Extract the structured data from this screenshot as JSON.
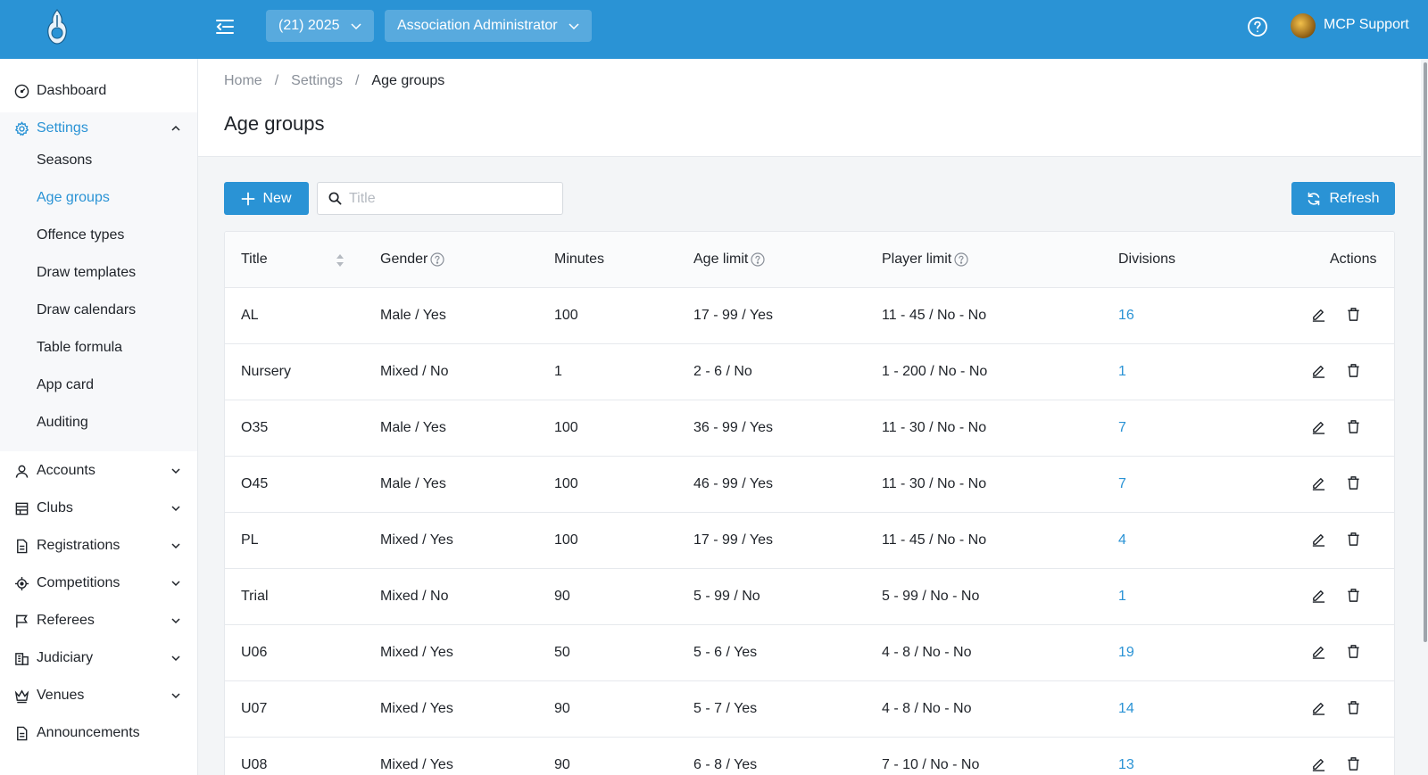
{
  "topbar": {
    "season_selector": "(21) 2025",
    "role_selector": "Association Administrator",
    "username": "MCP Support"
  },
  "sidebar": {
    "items": [
      {
        "label": "Dashboard",
        "icon": "dashboard-icon"
      },
      {
        "label": "Settings",
        "icon": "gear-icon"
      },
      {
        "label": "Accounts",
        "icon": "user-icon"
      },
      {
        "label": "Clubs",
        "icon": "building-icon"
      },
      {
        "label": "Registrations",
        "icon": "document-icon"
      },
      {
        "label": "Competitions",
        "icon": "target-icon"
      },
      {
        "label": "Referees",
        "icon": "flag-icon"
      },
      {
        "label": "Judiciary",
        "icon": "courthouse-icon"
      },
      {
        "label": "Venues",
        "icon": "crown-icon"
      },
      {
        "label": "Announcements",
        "icon": "document-icon"
      }
    ],
    "settings_sub": [
      "Seasons",
      "Age groups",
      "Offence types",
      "Draw templates",
      "Draw calendars",
      "Table formula",
      "App card",
      "Auditing"
    ]
  },
  "breadcrumb": [
    "Home",
    "Settings",
    "Age groups"
  ],
  "page_title": "Age groups",
  "toolbar": {
    "new_label": "New",
    "search_placeholder": "Title",
    "refresh_label": "Refresh"
  },
  "table": {
    "headers": {
      "title": "Title",
      "gender": "Gender",
      "minutes": "Minutes",
      "age_limit": "Age limit",
      "player_limit": "Player limit",
      "divisions": "Divisions",
      "actions": "Actions"
    },
    "rows": [
      {
        "title": "AL",
        "gender": "Male / Yes",
        "minutes": "100",
        "age_limit": "17 - 99 / Yes",
        "player_limit": "11 - 45 / No - No",
        "divisions": "16"
      },
      {
        "title": "Nursery",
        "gender": "Mixed / No",
        "minutes": "1",
        "age_limit": "2 - 6 / No",
        "player_limit": "1 - 200 / No - No",
        "divisions": "1"
      },
      {
        "title": "O35",
        "gender": "Male / Yes",
        "minutes": "100",
        "age_limit": "36 - 99 / Yes",
        "player_limit": "11 - 30 / No - No",
        "divisions": "7"
      },
      {
        "title": "O45",
        "gender": "Male / Yes",
        "minutes": "100",
        "age_limit": "46 - 99 / Yes",
        "player_limit": "11 - 30 / No - No",
        "divisions": "7"
      },
      {
        "title": "PL",
        "gender": "Mixed / Yes",
        "minutes": "100",
        "age_limit": "17 - 99 / Yes",
        "player_limit": "11 - 45 / No - No",
        "divisions": "4"
      },
      {
        "title": "Trial",
        "gender": "Mixed / No",
        "minutes": "90",
        "age_limit": "5 - 99 / No",
        "player_limit": "5 - 99 / No - No",
        "divisions": "1"
      },
      {
        "title": "U06",
        "gender": "Mixed / Yes",
        "minutes": "50",
        "age_limit": "5 - 6 / Yes",
        "player_limit": "4 - 8 / No - No",
        "divisions": "19"
      },
      {
        "title": "U07",
        "gender": "Mixed / Yes",
        "minutes": "90",
        "age_limit": "5 - 7 / Yes",
        "player_limit": "4 - 8 / No - No",
        "divisions": "14"
      },
      {
        "title": "U08",
        "gender": "Mixed / Yes",
        "minutes": "90",
        "age_limit": "6 - 8 / Yes",
        "player_limit": "7 - 10 / No - No",
        "divisions": "13"
      }
    ]
  },
  "colors": {
    "primary": "#2a93d5",
    "text": "#1f2329",
    "muted": "#8a9099"
  }
}
